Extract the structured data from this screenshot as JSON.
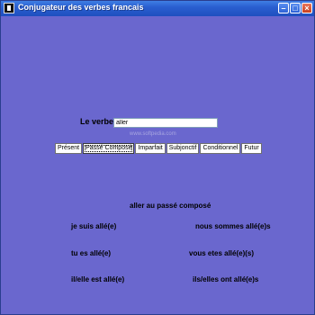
{
  "window": {
    "title": "Conjugateur des verbes francais"
  },
  "verb_label": "Le verbe:",
  "verb_input": {
    "value": "aller"
  },
  "watermark": "www.softpedia.com",
  "tenses": [
    "Présent",
    "Passé Composé",
    "Imparfait",
    "Subjonctif",
    "Conditionnel",
    "Futur"
  ],
  "selected_tense": "Passé Composé",
  "conjugation": {
    "heading": "aller au passé composé",
    "forms": [
      "je suis allé(e)",
      "nous sommes allé(e)s",
      "tu es allé(e)",
      "vous etes allé(e)(s)",
      "il/elle est allé(e)",
      "ils/elles ont allé(e)s"
    ]
  }
}
